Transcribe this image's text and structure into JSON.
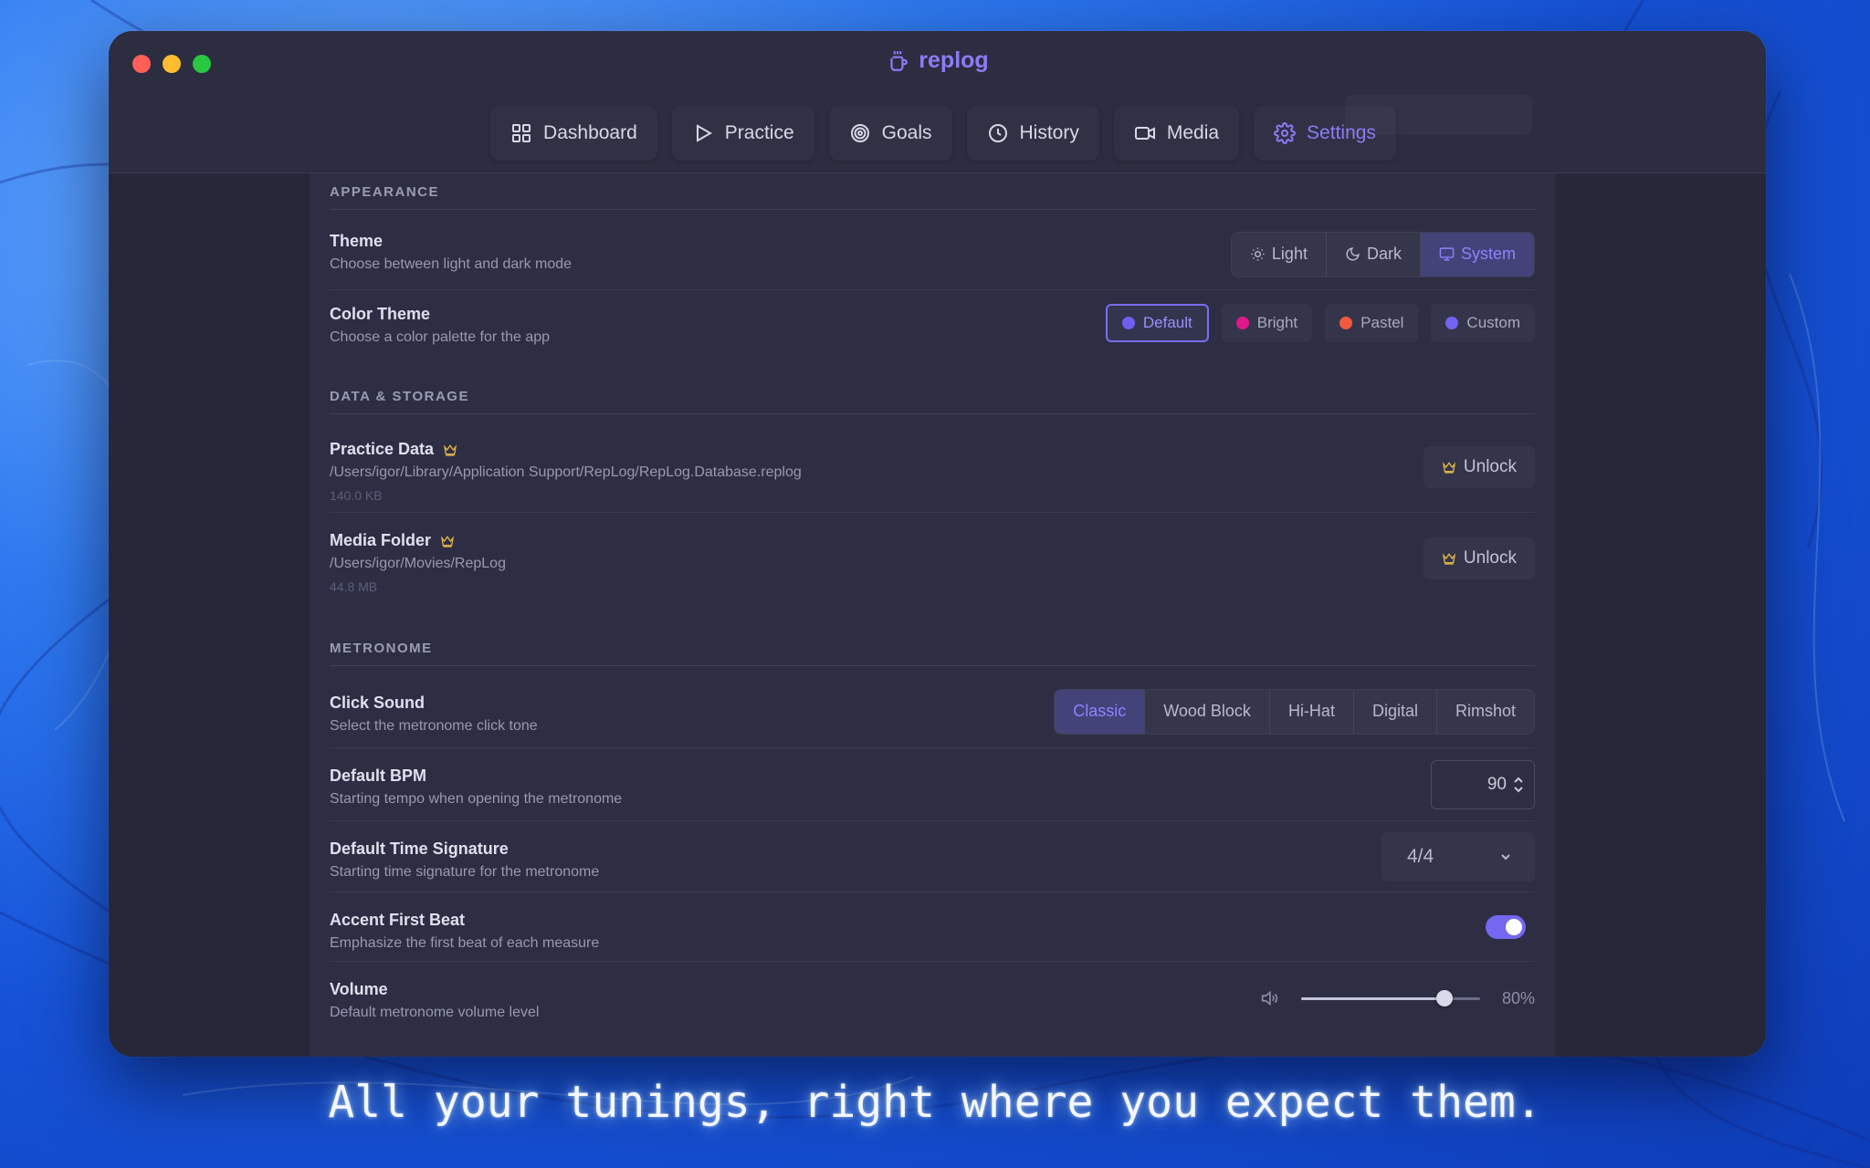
{
  "app": {
    "title": "replog"
  },
  "nav": [
    {
      "label": "Dashboard",
      "icon": "grid-icon"
    },
    {
      "label": "Practice",
      "icon": "play-icon"
    },
    {
      "label": "Goals",
      "icon": "target-icon"
    },
    {
      "label": "History",
      "icon": "clock-icon"
    },
    {
      "label": "Media",
      "icon": "video-icon"
    },
    {
      "label": "Settings",
      "icon": "gear-icon",
      "active": true
    }
  ],
  "appearance": {
    "section_title": "APPEARANCE",
    "theme": {
      "title": "Theme",
      "subtitle": "Choose between light and dark mode",
      "options": [
        "Light",
        "Dark",
        "System"
      ],
      "selected": "System"
    },
    "color_theme": {
      "title": "Color Theme",
      "subtitle": "Choose a color palette for the app",
      "options": [
        {
          "label": "Default",
          "color": "#6f5ef0"
        },
        {
          "label": "Bright",
          "color": "#e0198a"
        },
        {
          "label": "Pastel",
          "color": "#f05a3a"
        },
        {
          "label": "Custom",
          "color": "#7264f0"
        }
      ],
      "selected": "Default"
    }
  },
  "storage": {
    "section_title": "DATA & STORAGE",
    "practice_data": {
      "title": "Practice Data",
      "path": "/Users/igor/Library/Application Support/RepLog/RepLog.Database.replog",
      "size": "140.0 KB",
      "button": "Unlock"
    },
    "media_folder": {
      "title": "Media Folder",
      "path": "/Users/igor/Movies/RepLog",
      "size": "44.8 MB",
      "button": "Unlock"
    }
  },
  "metronome": {
    "section_title": "METRONOME",
    "click_sound": {
      "title": "Click Sound",
      "subtitle": "Select the metronome click tone",
      "options": [
        "Classic",
        "Wood Block",
        "Hi-Hat",
        "Digital",
        "Rimshot"
      ],
      "selected": "Classic"
    },
    "default_bpm": {
      "title": "Default BPM",
      "subtitle": "Starting tempo when opening the metronome",
      "value": "90"
    },
    "time_signature": {
      "title": "Default Time Signature",
      "subtitle": "Starting time signature for the metronome",
      "value": "4/4"
    },
    "accent_first_beat": {
      "title": "Accent First Beat",
      "subtitle": "Emphasize the first beat of each measure",
      "enabled": true
    },
    "volume": {
      "title": "Volume",
      "subtitle": "Default metronome volume level",
      "value_label": "80%",
      "level": 0.8
    }
  },
  "caption": "All your tunings, right where you expect them.",
  "colors": {
    "accent": "#8b7cf6",
    "window_bg": "#262739",
    "panel_bg": "#2d2e43"
  }
}
